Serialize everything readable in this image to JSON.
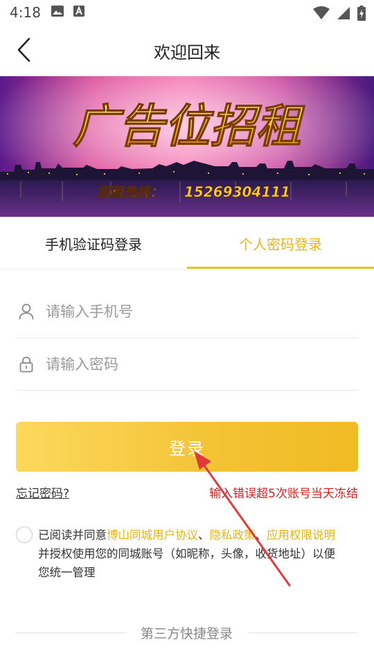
{
  "status_bar": {
    "time": "4:18",
    "icons": [
      "image-icon",
      "text-a-icon"
    ],
    "right_icons": [
      "wifi-icon",
      "signal-icon",
      "battery-charging-icon"
    ]
  },
  "header": {
    "back_icon": "chevron-left-icon",
    "title": "欢迎回来"
  },
  "banner": {
    "headline": "广告位招租",
    "hotline_label": "招租热线：",
    "hotline_number": "15269304111"
  },
  "tabs": [
    {
      "label": "手机验证码登录",
      "active": false
    },
    {
      "label": "个人密码登录",
      "active": true
    }
  ],
  "form": {
    "phone_placeholder": "请输入手机号",
    "phone_icon": "user-icon",
    "password_placeholder": "请输入密码",
    "password_icon": "lock-icon",
    "login_label": "登录"
  },
  "links": {
    "forgot": "忘记密码?",
    "freeze_warning": "输入错误超5次账号当天冻结"
  },
  "agreement": {
    "prefix": "已阅读并同意",
    "link1": "博山同城用户协议",
    "sep1": "、",
    "link2": "隐私政策",
    "sep2": "、",
    "link3": "应用权限说明",
    "suffix": "并授权使用您的同城账号（如昵称，头像，收货地址）以便您统一管理"
  },
  "third_party": {
    "label": "第三方快捷登录"
  },
  "colors": {
    "accent": "#f0c020",
    "warning": "#e01b1b",
    "annotation": "#e03a3a"
  }
}
